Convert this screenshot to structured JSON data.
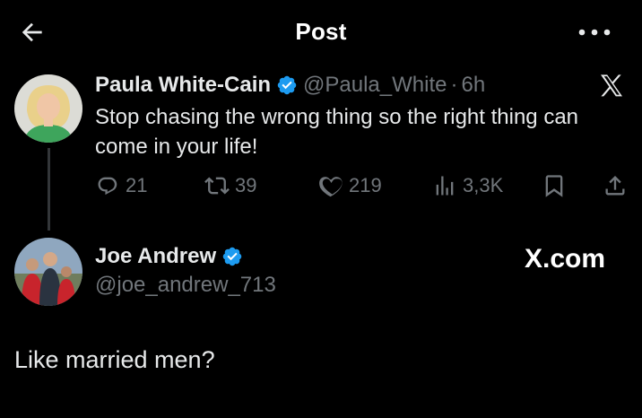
{
  "header": {
    "title": "Post",
    "back_icon": "arrow-left-icon",
    "more_icon": "more-horizontal-icon"
  },
  "post": {
    "author_name": "Paula White-Cain",
    "handle": "@Paula_White",
    "separator": "·",
    "time": "6h",
    "text": "Stop chasing the wrong thing so the right thing can come in your life!",
    "verified_color": "#1d9bf0",
    "actions": {
      "replies": "21",
      "retweets": "39",
      "likes": "219",
      "views": "3,3K"
    }
  },
  "reply": {
    "author_name": "Joe Andrew",
    "handle": "@joe_andrew_713",
    "watermark": "X.com",
    "text": "Like married men?"
  },
  "colors": {
    "background": "#000000",
    "text": "#e7e9ea",
    "muted": "#71767b",
    "accent": "#1d9bf0"
  }
}
